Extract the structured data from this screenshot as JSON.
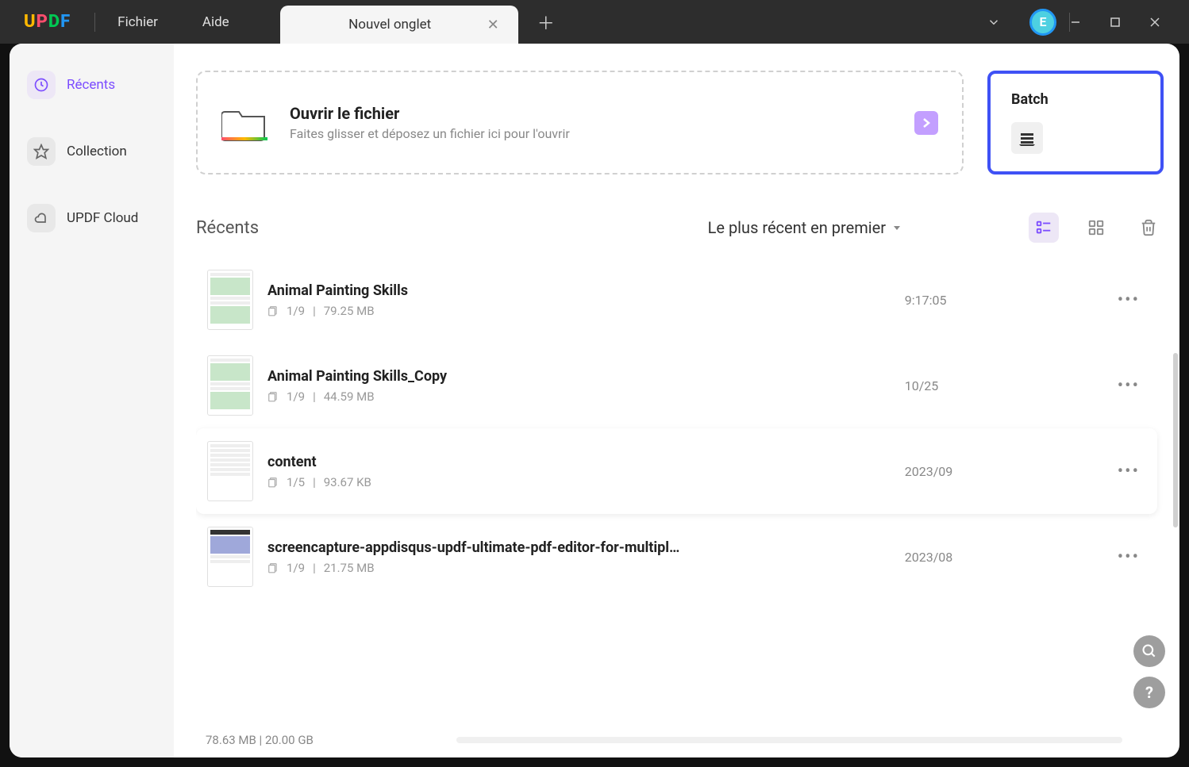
{
  "titlebar": {
    "logo": {
      "u": "U",
      "p": "P",
      "d": "D",
      "f": "F"
    },
    "menu": {
      "file": "Fichier",
      "help": "Aide"
    },
    "tab": {
      "title": "Nouvel onglet"
    },
    "avatar": "E"
  },
  "sidebar": {
    "items": [
      {
        "label": "Récents"
      },
      {
        "label": "Collection"
      },
      {
        "label": "UPDF Cloud"
      }
    ]
  },
  "open_card": {
    "title": "Ouvrir le fichier",
    "subtitle": "Faites glisser et déposez un fichier ici pour l'ouvrir"
  },
  "batch_card": {
    "title": "Batch"
  },
  "recents": {
    "heading": "Récents",
    "sort": "Le plus récent en premier",
    "files": [
      {
        "name": "Animal Painting Skills",
        "pages": "1/9",
        "size": "79.25 MB",
        "date": "9:17:05"
      },
      {
        "name": "Animal Painting Skills_Copy",
        "pages": "1/9",
        "size": "44.59 MB",
        "date": "10/25"
      },
      {
        "name": "content",
        "pages": "1/5",
        "size": "93.67 KB",
        "date": "2023/09"
      },
      {
        "name": "screencapture-appdisqus-updf-ultimate-pdf-editor-for-multipl...",
        "pages": "1/9",
        "size": "21.75 MB",
        "date": "2023/08"
      }
    ]
  },
  "footer": {
    "storage": "78.63 MB | 20.00 GB"
  }
}
